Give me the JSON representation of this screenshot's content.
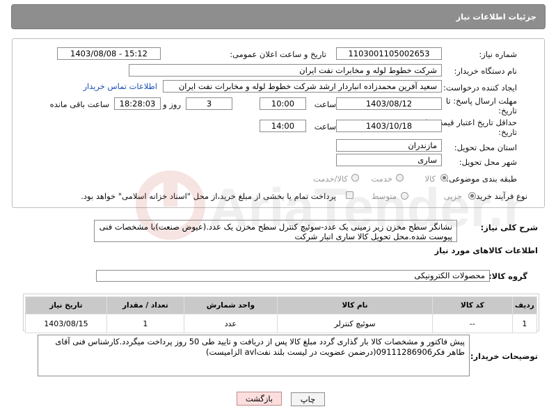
{
  "header": {
    "title": "جزئیات اطلاعات نیاز"
  },
  "form": {
    "need_number_label": "شماره نیاز:",
    "need_number": "1103001105002653",
    "announce_label": "تاریخ و ساعت اعلان عمومی:",
    "announce_value": "1403/08/08 - 15:12",
    "buyer_org_label": "نام دستگاه خریدار:",
    "buyer_org": "شرکت خطوط لوله و مخابرات نفت ایران",
    "requester_label": "ایجاد کننده درخواست:",
    "requester": "سعید آفرین محمدزاده انباردار ارشد شرکت خطوط لوله و مخابرات نفت ایران",
    "contact_link": "اطلاعات تماس خریدار",
    "deadline_label_1": "مهلت ارسال پاسخ: تا",
    "deadline_label_2": "تاریخ:",
    "deadline_date": "1403/08/12",
    "time_label": "ساعت",
    "deadline_time": "10:00",
    "days_value": "3",
    "days_label": "روز و",
    "remaining_time": "18:28:03",
    "remaining_label": "ساعت باقی مانده",
    "validity_label_1": "حداقل تاریخ اعتبار قیمت: تا",
    "validity_label_2": "تاریخ:",
    "validity_date": "1403/10/18",
    "validity_time": "14:00",
    "province_label": "استان محل تحویل:",
    "province": "مازندران",
    "city_label": "شهر محل تحویل:",
    "city": "ساری",
    "category_label": "طبقه بندی موضوعی:",
    "category_options": [
      "کالا",
      "خدمت",
      "کالا/خدمت"
    ],
    "process_label": "نوع فرآیند خرید :",
    "process_options": [
      "جزیی",
      "متوسط"
    ],
    "payment_note": "پرداخت تمام یا بخشی از مبلغ خرید،از محل \"اسناد خزانه اسلامی\" خواهد بود."
  },
  "description": {
    "label": "شرح کلی نیاز:",
    "text": "نشانگر سطح مخزن زیر زمینی یک عدد-سوئیچ کنترل سطح مخزن یک عدد.(عیوض صنعت)با مشخصات فنی پیوست شده.محل تحویل کالا ساری انبار شرکت"
  },
  "goods_section": {
    "title": "اطلاعات کالاهای مورد نیاز",
    "group_label": "گروه کالا:",
    "group_value": "محصولات الکترونیکی"
  },
  "table": {
    "headers": [
      "ردیف",
      "کد کالا",
      "نام کالا",
      "واحد شمارش",
      "تعداد / مقدار",
      "تاریخ نیاز"
    ],
    "rows": [
      [
        "1",
        "--",
        "سوئیچ کنترلر",
        "عدد",
        "1",
        "1403/08/15"
      ]
    ]
  },
  "buyer_notes": {
    "label": "توضیحات خریدار:",
    "text": "پیش فاکتور و مشخصات کالا بار گذاری گردد مبلغ کالا پس از دریافت و تایید طی 50 روز پرداخت میگردد.کارشناس فنی آقای طاهر فکر09111286906(درضمن عضویت در لیست بلند نفتavl الزامیست)"
  },
  "buttons": {
    "print": "چاپ",
    "back": "بازگشت"
  },
  "watermark": {
    "text": "AriaTender.net"
  },
  "colors": {
    "header_bg": "#8e8e8e",
    "link": "#1a4fb3",
    "table_header": "#c9c9c9",
    "back_button": "#fcdede"
  }
}
